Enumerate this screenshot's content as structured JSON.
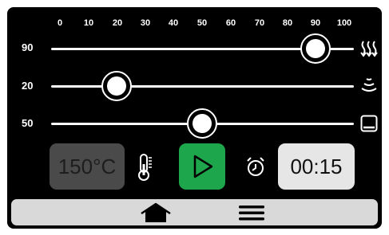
{
  "scale": {
    "ticks": [
      "0",
      "10",
      "20",
      "30",
      "40",
      "50",
      "60",
      "70",
      "80",
      "90",
      "100"
    ]
  },
  "sliders": [
    {
      "label": "90",
      "value": 90,
      "icon": "radiant-heat-icon"
    },
    {
      "label": "20",
      "value": 20,
      "icon": "fan-airflow-icon"
    },
    {
      "label": "50",
      "value": 50,
      "icon": "bottom-heat-icon"
    }
  ],
  "controls": {
    "temperature": "150°C",
    "temperature_icon": "thermometer-icon",
    "start_icon": "play-icon",
    "timer_icon": "alarm-clock-icon",
    "time": "00:15"
  },
  "nav": {
    "home_icon": "home-icon",
    "menu_icon": "hamburger-menu-icon"
  },
  "colors": {
    "background": "#000000",
    "start_button": "#1ea64c",
    "temp_box": "#4a4a4a",
    "time_box": "#e6e6e6",
    "nav_bar": "#d9d9d9"
  }
}
